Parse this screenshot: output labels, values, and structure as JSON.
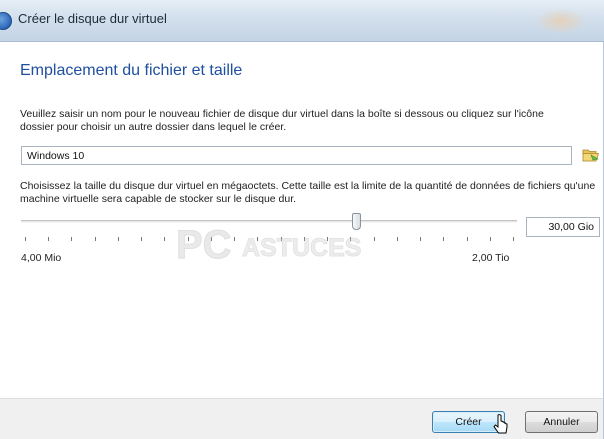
{
  "window": {
    "title": "Créer le disque dur virtuel"
  },
  "page": {
    "heading": "Emplacement du fichier et taille",
    "file_description": "Veuillez saisir un nom pour le nouveau fichier de disque dur virtuel dans la boîte si dessous ou cliquez sur l'icône dossier pour choisir un autre dossier dans lequel le créer.",
    "file_name_value": "Windows 10",
    "size_description": "Choisissez la taille du disque dur virtuel en mégaoctets. Cette taille est la limite de la quantité de données de fichiers qu'une machine virtuelle sera capable de stocker sur le disque dur.",
    "size_value": "30,00 Gio",
    "size_min_label": "4,00 Mio",
    "size_max_label": "2,00 Tio",
    "slider_position_fraction": 0.675,
    "slider_tick_count": 22
  },
  "icons": {
    "folder": "folder-open-icon",
    "title": "virtualbox-icon"
  },
  "watermark": {
    "text_main": "PC",
    "text_sub": "ASTUCES"
  },
  "footer": {
    "create_label": "Créer",
    "cancel_label": "Annuler"
  },
  "colors": {
    "heading": "#1f4fa0",
    "default_button_border": "#3c7fb1"
  }
}
